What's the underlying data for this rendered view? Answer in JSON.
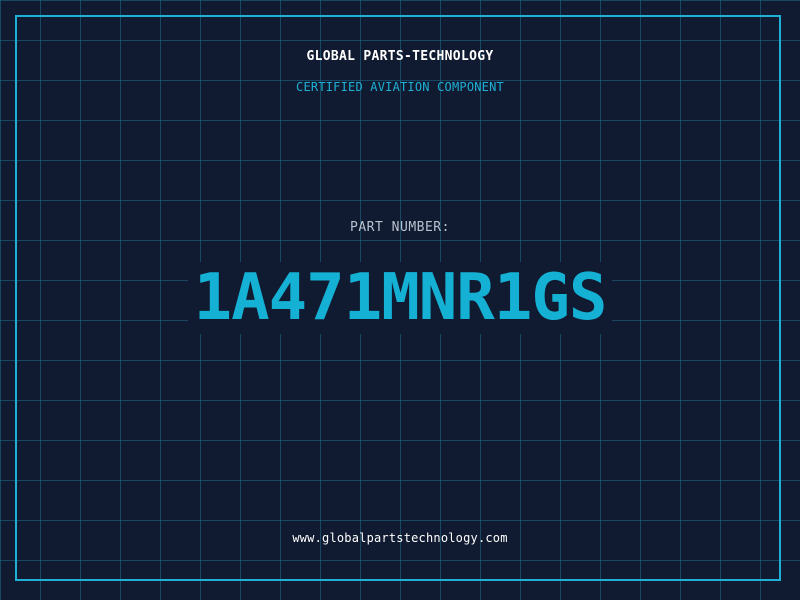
{
  "header": {
    "company": "GLOBAL PARTS-TECHNOLOGY",
    "tagline": "CERTIFIED AVIATION COMPONENT"
  },
  "part": {
    "label": "PART NUMBER:",
    "number": "1A471MNR1GS"
  },
  "footer": {
    "website": "www.globalpartstechnology.com"
  },
  "colors": {
    "background": "#101a30",
    "accent": "#14b1d4",
    "grid": "#1e6e8c",
    "text_primary": "#ffffff",
    "text_muted": "#b8c2d0"
  }
}
